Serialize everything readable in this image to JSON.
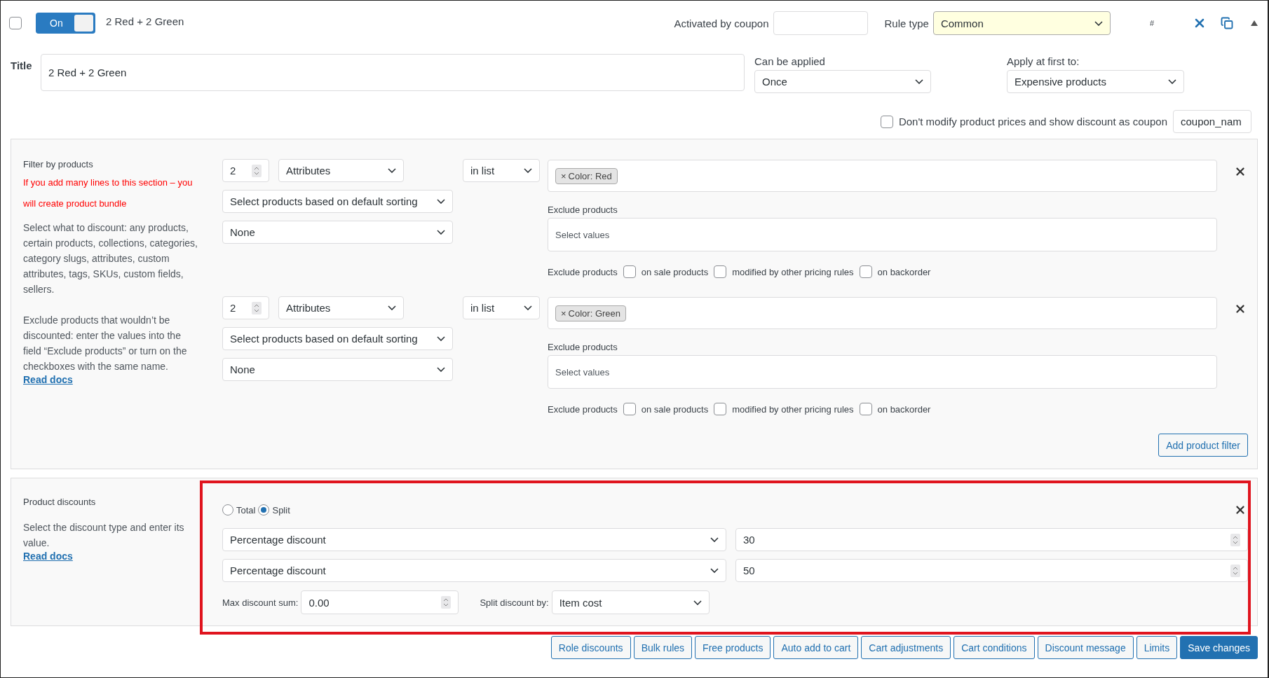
{
  "rule": {
    "selected": false,
    "enabled": true,
    "toggle_label": "On",
    "name": "2 Red + 2 Green"
  },
  "header": {
    "coupon_label": "Activated by coupon",
    "rule_type_label": "Rule type",
    "rule_type": "Common",
    "hash": "#"
  },
  "title": {
    "label": "Title",
    "value": "2 Red + 2 Green"
  },
  "can_be_applied": {
    "label": "Can be applied",
    "value": "Once"
  },
  "apply_first": {
    "label": "Apply at first to:",
    "value": "Expensive products"
  },
  "coupon_option": {
    "checked": false,
    "label": "Don't modify product prices and show discount as coupon",
    "value": "coupon_nam"
  },
  "filter": {
    "heading": "Filter by products",
    "warning": "If you add many lines to this section – you will create product bundle",
    "description": "Select what to discount: any products, certain products, collections, categories, category slugs, attributes, custom attributes, tags, SKUs, custom fields, sellers.",
    "exclude_description": "Exclude products that wouldn’t be discounted: enter the values into the field “Exclude products” or turn on the checkboxes with the same name.",
    "read_docs": "Read docs",
    "lines": [
      {
        "qty": "2",
        "type": "Attributes",
        "operator": "in list",
        "tags": [
          {
            "remove": "×",
            "label": "Color: Red"
          }
        ],
        "sorting": "Select products based on default sorting",
        "limit": "None",
        "exclude_label": "Exclude products",
        "exclude_placeholder": "Select values",
        "checks_label": "Exclude products",
        "checks": [
          {
            "label": "on sale products",
            "checked": false
          },
          {
            "label": "modified by other pricing rules",
            "checked": false
          },
          {
            "label": "on backorder",
            "checked": false
          }
        ]
      },
      {
        "qty": "2",
        "type": "Attributes",
        "operator": "in list",
        "tags": [
          {
            "remove": "×",
            "label": "Color: Green"
          }
        ],
        "sorting": "Select products based on default sorting",
        "limit": "None",
        "exclude_label": "Exclude products",
        "exclude_placeholder": "Select values",
        "checks_label": "Exclude products",
        "checks": [
          {
            "label": "on sale products",
            "checked": false
          },
          {
            "label": "modified by other pricing rules",
            "checked": false
          },
          {
            "label": "on backorder",
            "checked": false
          }
        ]
      }
    ],
    "add_button": "Add product filter"
  },
  "discounts": {
    "heading": "Product discounts",
    "description": "Select the discount type and enter its value.",
    "read_docs": "Read docs",
    "highlighted": true,
    "modes": [
      {
        "label": "Total",
        "selected": false
      },
      {
        "label": "Split",
        "selected": true
      }
    ],
    "rows": [
      {
        "type": "Percentage discount",
        "value": "30"
      },
      {
        "type": "Percentage discount",
        "value": "50"
      }
    ],
    "max_label": "Max discount sum:",
    "max_value": "0.00",
    "split_label": "Split discount by:",
    "split_value": "Item cost"
  },
  "buttons": [
    {
      "label": "Role discounts",
      "primary": false
    },
    {
      "label": "Bulk rules",
      "primary": false
    },
    {
      "label": "Free products",
      "primary": false
    },
    {
      "label": "Auto add to cart",
      "primary": false
    },
    {
      "label": "Cart adjustments",
      "primary": false
    },
    {
      "label": "Cart conditions",
      "primary": false
    },
    {
      "label": "Discount message",
      "primary": false
    },
    {
      "label": "Limits",
      "primary": false
    },
    {
      "label": "Save changes",
      "primary": true
    }
  ]
}
